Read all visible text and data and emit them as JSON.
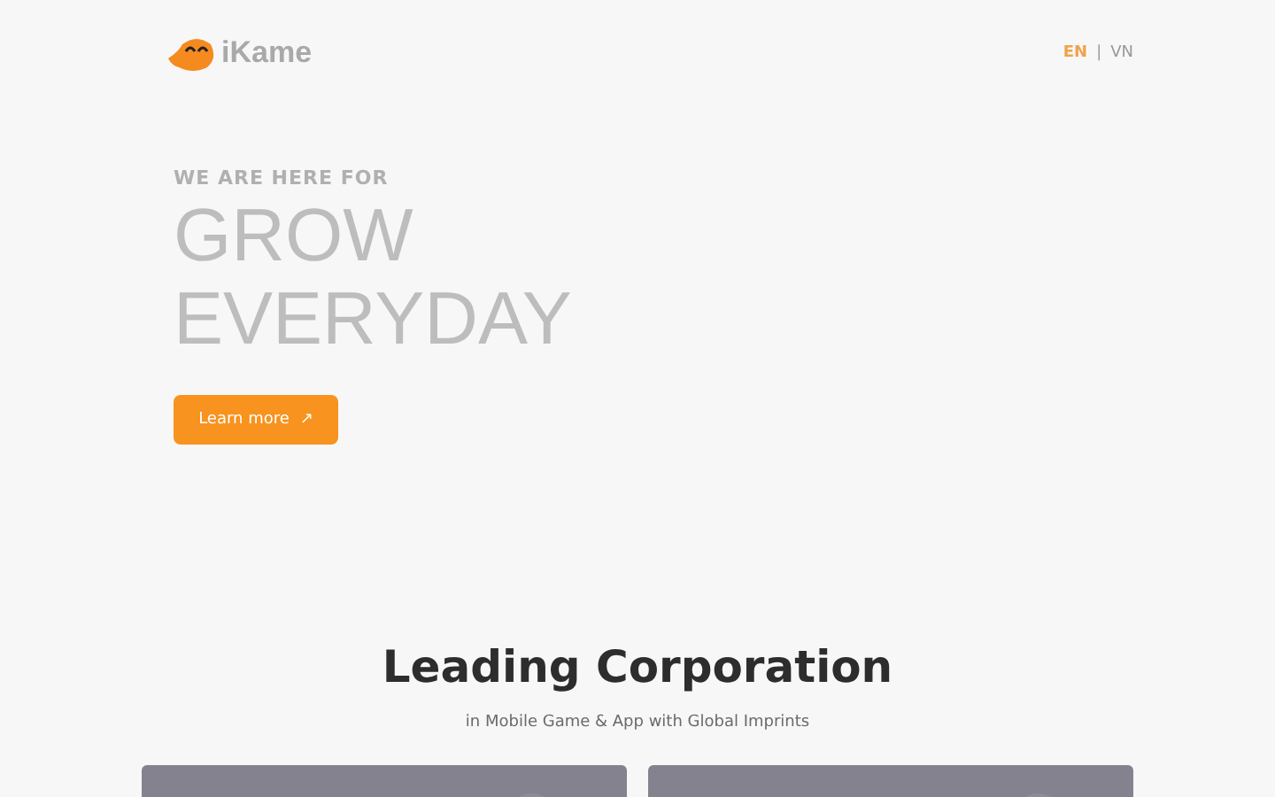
{
  "header": {
    "logo": "iKame",
    "languages": [
      {
        "label": "EN",
        "selected": true
      },
      {
        "label": "VN",
        "selected": false
      }
    ],
    "separator": "|"
  },
  "hero": {
    "eyebrow": "WE ARE HERE FOR",
    "headline": [
      "GROW",
      "EVERYDAY"
    ],
    "button": {
      "label": "Learn more",
      "icon": "↗"
    }
  },
  "section": {
    "title": "Leading Corporation",
    "subtitle": "in Mobile Game & App with Global Imprints"
  }
}
